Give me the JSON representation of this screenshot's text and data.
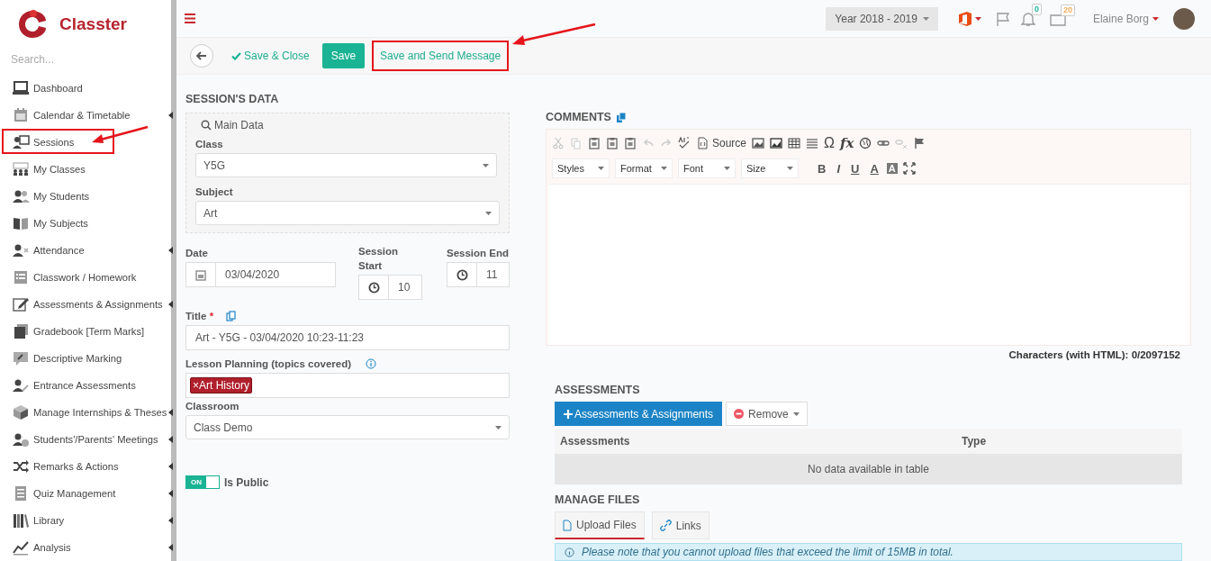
{
  "app": {
    "logo_text": "Classter"
  },
  "sidebar": {
    "search_placeholder": "Search...",
    "items": [
      {
        "label": "Dashboard",
        "has_submenu": false,
        "highlighted": false
      },
      {
        "label": "Calendar & Timetable",
        "has_submenu": true,
        "highlighted": false
      },
      {
        "label": "Sessions",
        "has_submenu": false,
        "highlighted": true
      },
      {
        "label": "My Classes",
        "has_submenu": false,
        "highlighted": false
      },
      {
        "label": "My Students",
        "has_submenu": false,
        "highlighted": false
      },
      {
        "label": "My Subjects",
        "has_submenu": false,
        "highlighted": false
      },
      {
        "label": "Attendance",
        "has_submenu": true,
        "highlighted": false
      },
      {
        "label": "Classwork / Homework",
        "has_submenu": false,
        "highlighted": false
      },
      {
        "label": "Assessments & Assignments",
        "has_submenu": true,
        "highlighted": false
      },
      {
        "label": "Gradebook [Term Marks]",
        "has_submenu": false,
        "highlighted": false
      },
      {
        "label": "Descriptive Marking",
        "has_submenu": false,
        "highlighted": false
      },
      {
        "label": "Entrance Assessments",
        "has_submenu": false,
        "highlighted": false
      },
      {
        "label": "Manage Internships & Theses",
        "has_submenu": true,
        "highlighted": false
      },
      {
        "label": "Students'/Parents' Meetings",
        "has_submenu": true,
        "highlighted": false
      },
      {
        "label": "Remarks & Actions",
        "has_submenu": true,
        "highlighted": false
      },
      {
        "label": "Quiz Management",
        "has_submenu": true,
        "highlighted": false
      },
      {
        "label": "Library",
        "has_submenu": true,
        "highlighted": false
      },
      {
        "label": "Analysis",
        "has_submenu": true,
        "highlighted": false
      }
    ]
  },
  "header": {
    "year": "Year 2018 - 2019",
    "notifications_count": "0",
    "messages_count": "20",
    "user_name": "Elaine Borg"
  },
  "toolbar": {
    "buttons": [
      {
        "label": "Save & Close",
        "kind": "check-link",
        "highlighted": false
      },
      {
        "label": "Save",
        "kind": "primary",
        "highlighted": false
      },
      {
        "label": "Save and Send Message",
        "kind": "link",
        "highlighted": true
      }
    ]
  },
  "session_data": {
    "heading": "SESSION'S DATA",
    "main_data_legend": "Main Data",
    "class_label": "Class",
    "class_value": "Y5G",
    "subject_label": "Subject",
    "subject_value": "Art",
    "date_label": "Date",
    "date_value": "03/04/2020",
    "start_label": "Session Start",
    "start_value": "10",
    "end_label": "Session End",
    "end_value": "11",
    "title_label": "Title",
    "required_mark": "*",
    "title_value": "Art - Y5G - 03/04/2020 10:23-11:23",
    "lesson_label": "Lesson Planning (topics covered)",
    "topics": [
      {
        "remove": "×",
        "label": "Art History"
      }
    ],
    "classroom_label": "Classroom",
    "classroom_value": "Class Demo",
    "public_toggle": {
      "on_text": "ON",
      "on": true,
      "label": "Is Public"
    }
  },
  "comments": {
    "heading": "COMMENTS",
    "source_label": "Source",
    "special_char": "Ω",
    "remove_format": "fx",
    "dropdowns": [
      "Styles",
      "Format",
      "Font",
      "Size"
    ],
    "style_buttons": [
      "B",
      "I",
      "U"
    ],
    "color_buttons": [
      "A",
      "A"
    ],
    "char_count": "Characters (with HTML): 0/2097152"
  },
  "assessments": {
    "heading": "ASSESSMENTS",
    "add_button": "Assessments & Assignments",
    "remove_button": "Remove",
    "columns": [
      "Assessments",
      "Type"
    ],
    "empty_text": "No data available in table"
  },
  "files": {
    "heading": "MANAGE FILES",
    "tabs": [
      {
        "label": "Upload Files",
        "selected": true
      },
      {
        "label": "Links",
        "selected": false
      }
    ],
    "notice": "Please note that you cannot upload files that exceed the limit of 15MB in total."
  }
}
